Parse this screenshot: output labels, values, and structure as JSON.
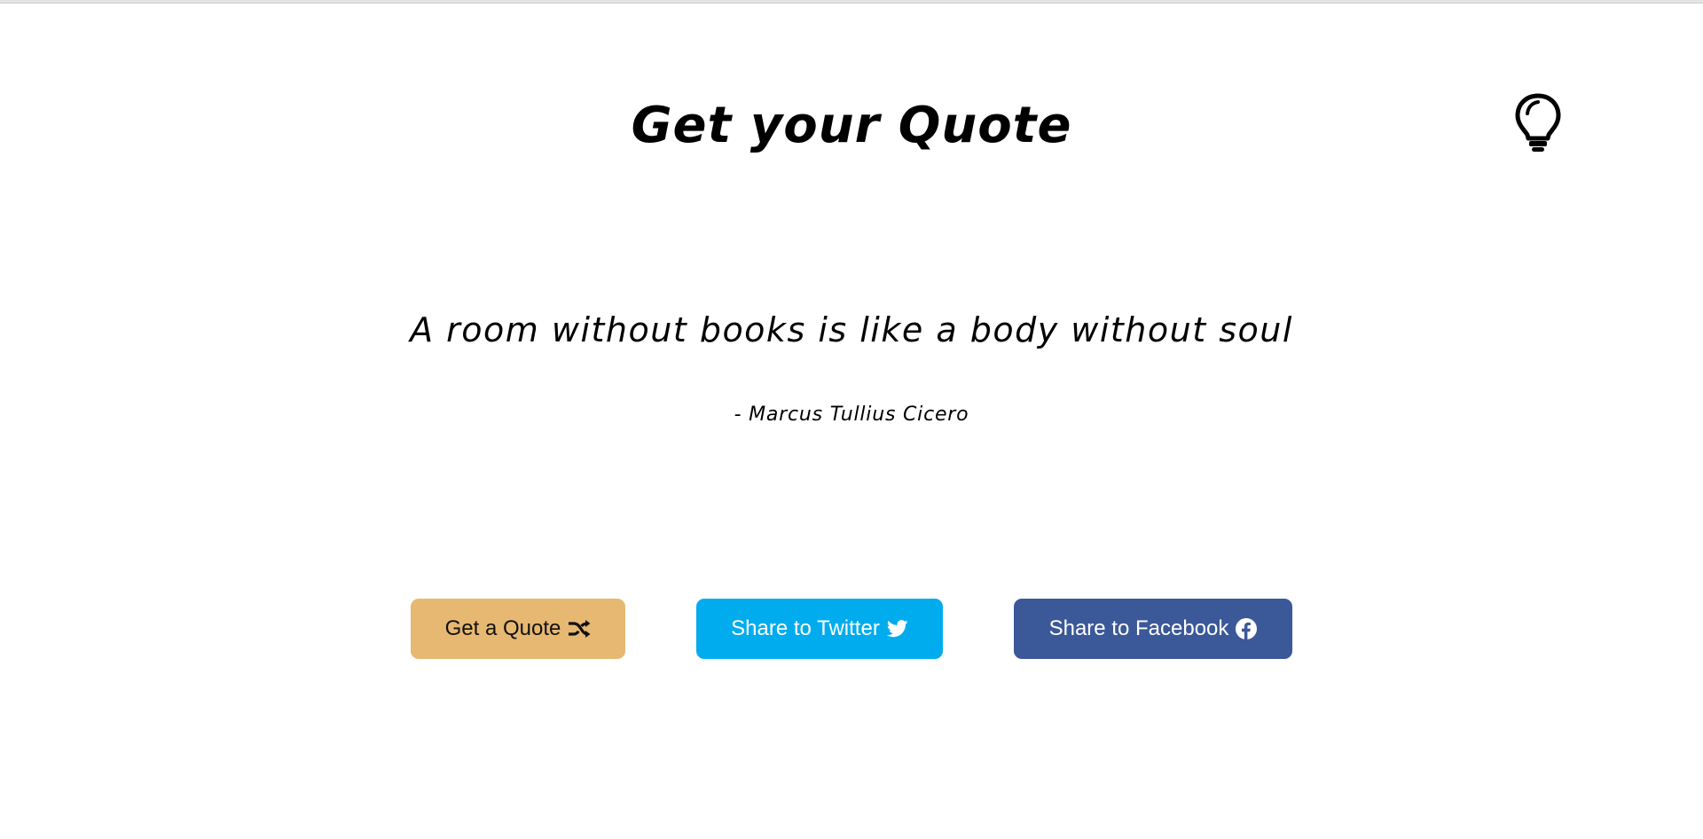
{
  "header": {
    "title": "Get your Quote"
  },
  "icons": {
    "theme_toggle": "lightbulb-icon",
    "shuffle": "shuffle-icon",
    "twitter": "twitter-icon",
    "facebook": "facebook-icon"
  },
  "quote": {
    "text": "A room without books is like a body without soul",
    "author": "- Marcus Tullius Cicero"
  },
  "actions": {
    "get_quote_label": "Get a Quote",
    "twitter_label": "Share to Twitter",
    "facebook_label": "Share to Facebook"
  },
  "colors": {
    "get_quote_bg": "#e7b872",
    "twitter_bg": "#00acee",
    "facebook_bg": "#3b5998"
  }
}
